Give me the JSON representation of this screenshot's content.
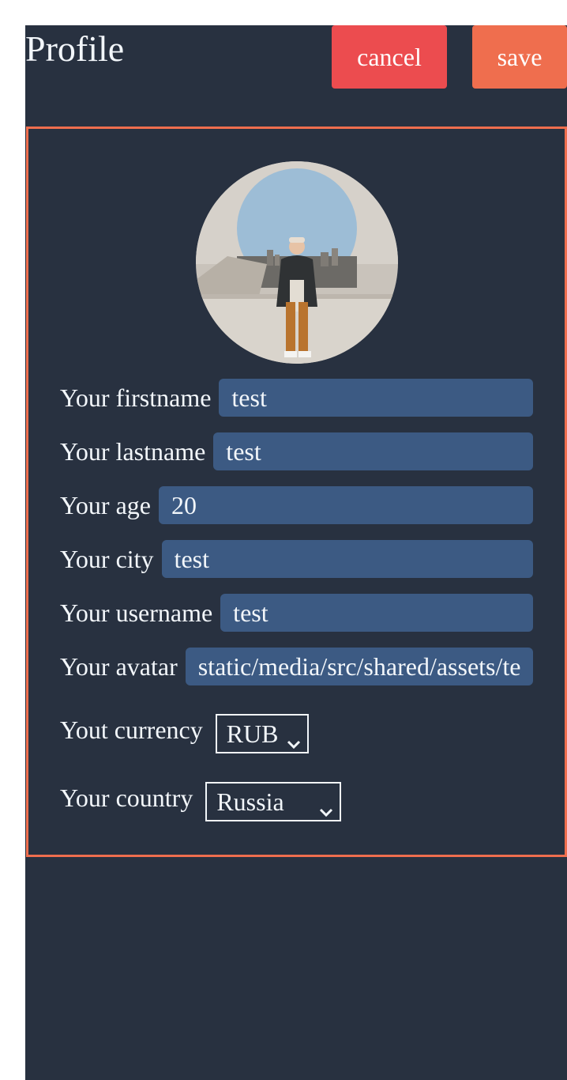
{
  "header": {
    "title": "Profile",
    "cancel_label": "cancel",
    "save_label": "save"
  },
  "form": {
    "fields": [
      {
        "label": "Your firstname",
        "value": "test"
      },
      {
        "label": "Your lastname",
        "value": "test"
      },
      {
        "label": "Your age",
        "value": "20"
      },
      {
        "label": "Your city",
        "value": "test"
      },
      {
        "label": "Your username",
        "value": "test"
      },
      {
        "label": "Your avatar",
        "value": "static/media/src/shared/assets/te"
      }
    ],
    "currency": {
      "label": "Yout currency",
      "selected": "RUB"
    },
    "country": {
      "label": "Your country",
      "selected": "Russia"
    }
  },
  "colors": {
    "background": "#283140",
    "accent": "#ef6e4e",
    "cancel": "#ec4c4f",
    "input": "#3c5a83",
    "text": "#f2f6fa"
  },
  "icons": {
    "select_arrow": "chevron-down-icon"
  }
}
